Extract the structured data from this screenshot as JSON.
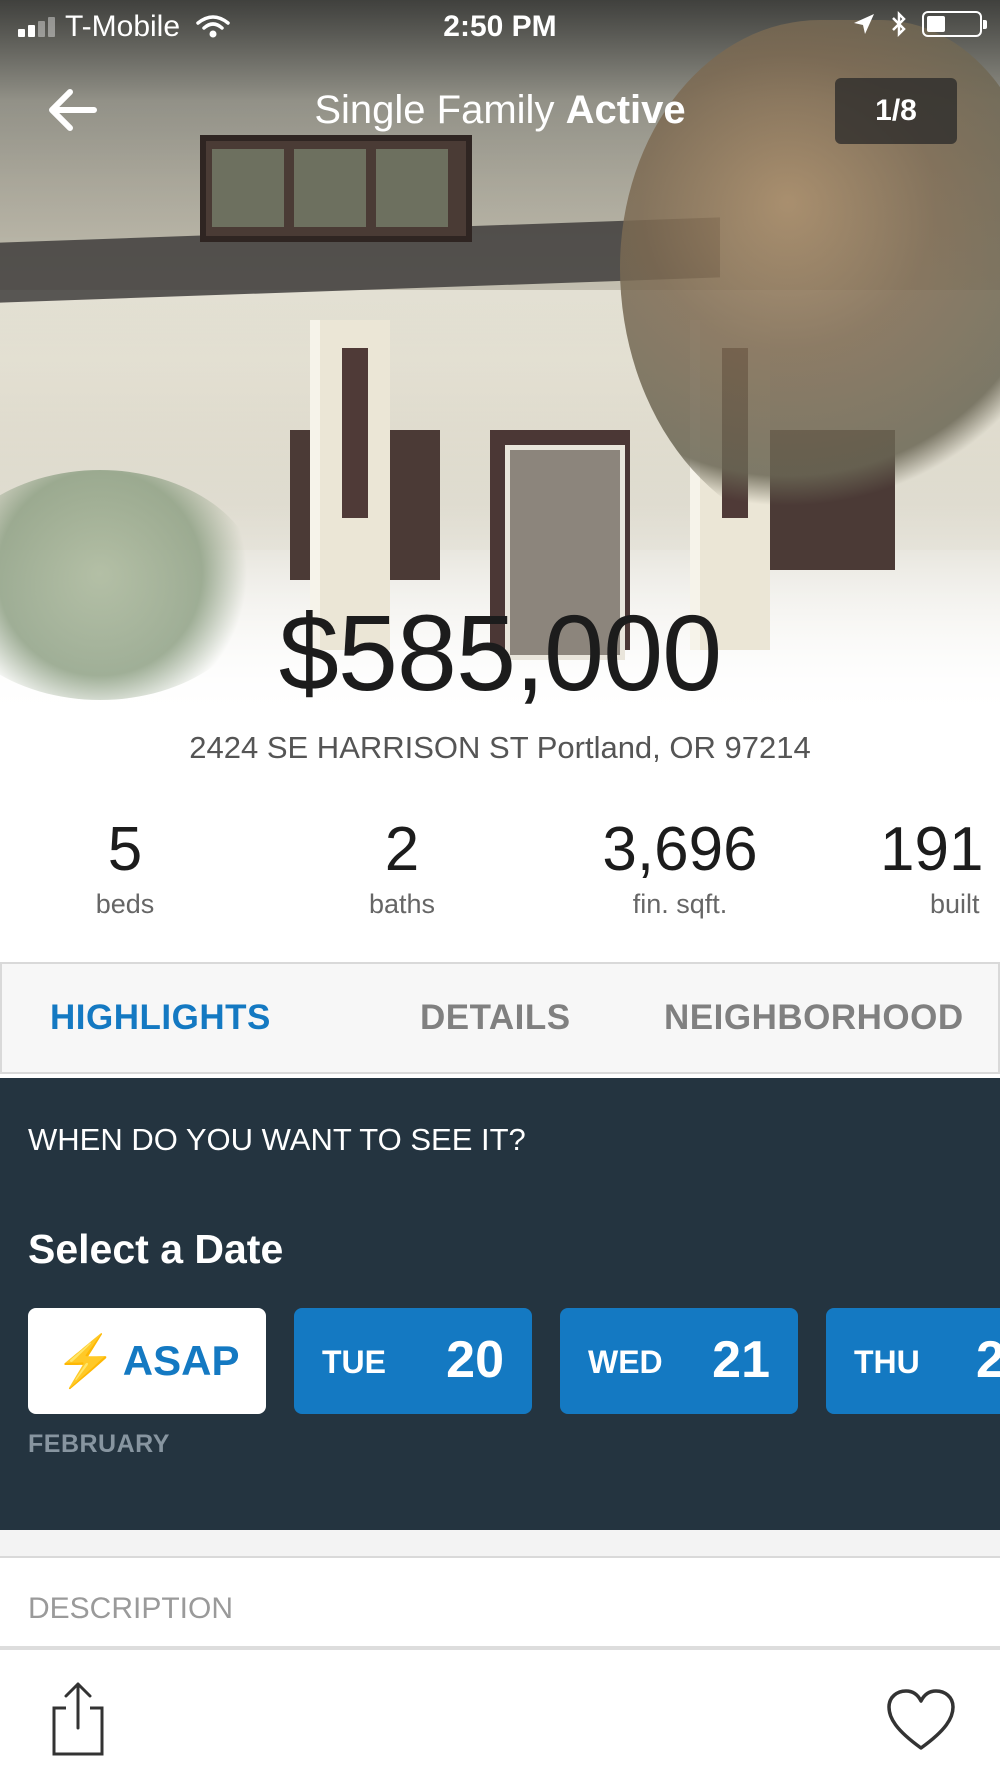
{
  "status_bar": {
    "carrier": "T-Mobile",
    "time": "2:50 PM"
  },
  "nav": {
    "title_prefix": "Single Family",
    "title_status": "Active",
    "photo_counter": "1/8"
  },
  "listing": {
    "price": "$585,000",
    "address": "2424 SE HARRISON ST  Portland, OR 97214"
  },
  "stats": [
    {
      "value": "5",
      "label": "beds"
    },
    {
      "value": "2",
      "label": "baths"
    },
    {
      "value": "3,696",
      "label": "fin. sqft."
    },
    {
      "value": "191",
      "label": "built"
    }
  ],
  "tabs": [
    "HIGHLIGHTS",
    "DETAILS",
    "NEIGHBORHOOD"
  ],
  "schedule": {
    "question": "WHEN DO YOU WANT TO SEE IT?",
    "title": "Select a Date",
    "asap": "ASAP",
    "month": "FEBRUARY",
    "dates": [
      {
        "dow": "TUE",
        "day": "20"
      },
      {
        "dow": "WED",
        "day": "21"
      },
      {
        "dow": "THU",
        "day": "2"
      }
    ]
  },
  "description_label": "DESCRIPTION",
  "colors": {
    "accent": "#1479c2",
    "schedule_bg": "#243440",
    "bolt": "#f2b51a"
  },
  "icons": {
    "back": "back-arrow-icon",
    "share": "share-icon",
    "favorite": "heart-icon"
  }
}
